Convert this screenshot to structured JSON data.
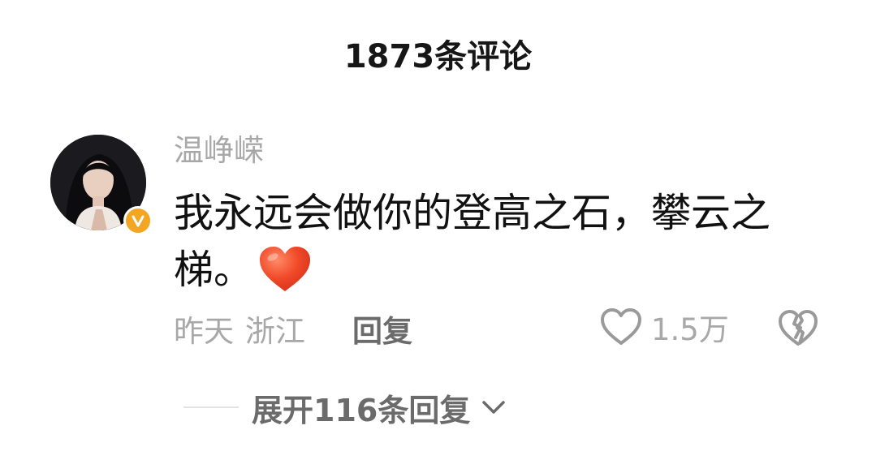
{
  "header": {
    "title": "1873条评论"
  },
  "comment": {
    "username": "温峥嵘",
    "text": "我永远会做你的登高之石，攀云之梯。",
    "time": "昨天",
    "location": "浙江",
    "reply_label": "回复",
    "like_count": "1.5万"
  },
  "replies": {
    "expand_label": "展开116条回复"
  },
  "icons": {
    "verified": "verified-badge-icon",
    "heart_emoji": "red-heart-emoji-icon",
    "like": "heart-outline-icon",
    "dislike": "broken-heart-icon",
    "expand": "chevron-down-icon"
  },
  "colors": {
    "badge": "#f2a623",
    "heart_emoji": "#f04a2a",
    "muted_text": "#a8a8a8",
    "secondary_text": "#6b6b6b",
    "primary_text": "#111111"
  }
}
